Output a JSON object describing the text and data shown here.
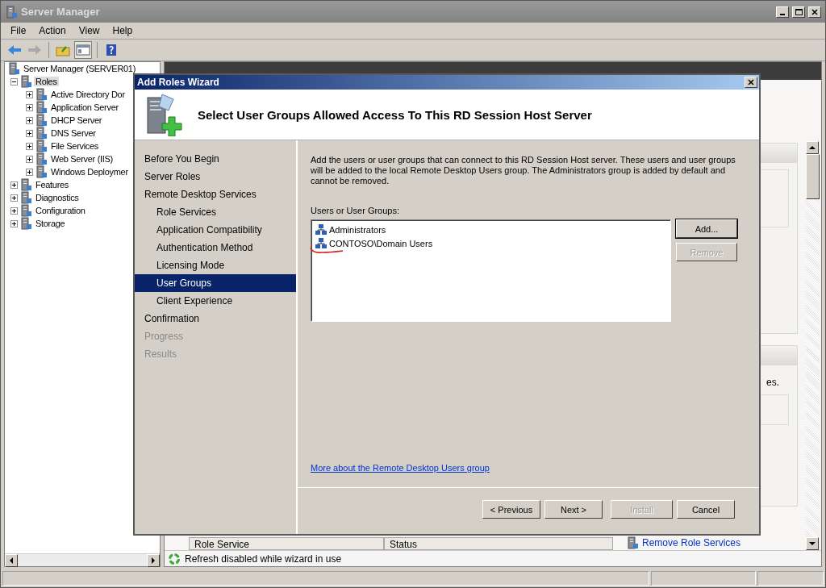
{
  "window": {
    "title": "Server Manager"
  },
  "menu": [
    "File",
    "Action",
    "View",
    "Help"
  ],
  "tree": [
    {
      "label": "Server Manager (SERVER01)",
      "selected": false,
      "children": [
        {
          "label": "Roles",
          "expanded": true,
          "selected": true,
          "children": [
            {
              "label": "Active Directory Dor",
              "expanded": false,
              "selected": false
            },
            {
              "label": "Application Server",
              "expanded": false,
              "selected": false
            },
            {
              "label": "DHCP Server",
              "expanded": false,
              "selected": false
            },
            {
              "label": "DNS Server",
              "expanded": false,
              "selected": false
            },
            {
              "label": "File Services",
              "expanded": false,
              "selected": false
            },
            {
              "label": "Web Server (IIS)",
              "expanded": false,
              "selected": false
            },
            {
              "label": "Windows Deploymer",
              "expanded": false,
              "selected": false
            }
          ]
        },
        {
          "label": "Features",
          "expanded": false,
          "selected": false
        },
        {
          "label": "Diagnostics",
          "expanded": false,
          "selected": false
        },
        {
          "label": "Configuration",
          "expanded": false,
          "selected": false
        },
        {
          "label": "Storage",
          "expanded": false,
          "selected": false
        }
      ]
    }
  ],
  "details": {
    "section_text": "es.",
    "table_columns": [
      "Role Service",
      "Status"
    ],
    "link": "Remove Role Services",
    "notice": "Refresh disabled while wizard in use"
  },
  "dialog": {
    "title": "Add Roles Wizard",
    "heading": "Select User Groups Allowed Access To This RD Session Host Server",
    "steps": [
      {
        "label": "Before You Begin",
        "selected": false,
        "disabled": false
      },
      {
        "label": "Server Roles",
        "selected": false,
        "disabled": false
      },
      {
        "label": "Remote Desktop Services",
        "selected": false,
        "disabled": false,
        "children": [
          {
            "label": "Role Services",
            "selected": false,
            "disabled": false
          },
          {
            "label": "Application Compatibility",
            "selected": false,
            "disabled": false
          },
          {
            "label": "Authentication Method",
            "selected": false,
            "disabled": false
          },
          {
            "label": "Licensing Mode",
            "selected": false,
            "disabled": false
          },
          {
            "label": "User Groups",
            "selected": true,
            "disabled": false
          },
          {
            "label": "Client Experience",
            "selected": false,
            "disabled": false
          }
        ]
      },
      {
        "label": "Confirmation",
        "selected": false,
        "disabled": false
      },
      {
        "label": "Progress",
        "selected": false,
        "disabled": true
      },
      {
        "label": "Results",
        "selected": false,
        "disabled": true
      }
    ],
    "description": "Add the users or user groups that can connect to this RD Session Host server. These users and user groups will be added to the local Remote Desktop Users group. The Administrators group is added by default and cannot be removed.",
    "list_label": "Users or User Groups:",
    "users": [
      "Administrators",
      "CONTOSO\\Domain Users"
    ],
    "side_buttons": [
      {
        "label": "Add...",
        "default": true,
        "disabled": false
      },
      {
        "label": "Remove",
        "default": false,
        "disabled": true
      }
    ],
    "link": "More about the Remote Desktop Users group",
    "footer_buttons": [
      {
        "label": "< Previous",
        "disabled": false
      },
      {
        "label": "Next >",
        "disabled": false
      },
      {
        "label": "Install",
        "disabled": true
      },
      {
        "label": "Cancel",
        "disabled": false
      }
    ]
  }
}
